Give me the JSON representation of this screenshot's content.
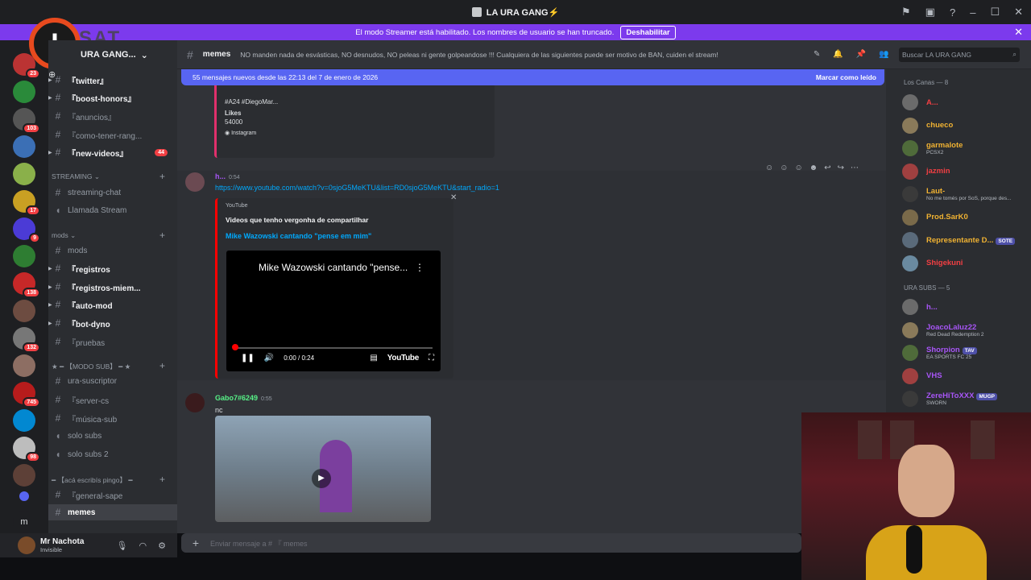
{
  "window": {
    "title": "LA URA GANG⚡️"
  },
  "banner": {
    "text": "El modo Streamer está habilitado. Los nombres de usuario se han truncado.",
    "button": "Deshabilitar"
  },
  "server": {
    "name": "URA GANG..."
  },
  "rail_badges": [
    "23",
    "103",
    "17",
    "9",
    "138",
    "132",
    "745",
    "98"
  ],
  "channels": [
    {
      "label": "『twitter』",
      "bold": true
    },
    {
      "label": "『boost-honors』",
      "bold": true
    },
    {
      "label": "『anuncios』",
      "bold": false
    },
    {
      "label": "『como-tener-rang...",
      "bold": false
    },
    {
      "label": "『new-videos』",
      "bold": true,
      "badge": "44"
    }
  ],
  "cat_streaming": "STREAMING",
  "streaming_channels": [
    "streaming-chat",
    "Llamada Stream"
  ],
  "cat_mods": "mods",
  "mods_channels": [
    {
      "label": "mods",
      "bold": false
    },
    {
      "label": "『registros",
      "bold": true
    },
    {
      "label": "『registros-miem...",
      "bold": true
    },
    {
      "label": "『auto-mod",
      "bold": true
    },
    {
      "label": "『bot-dyno",
      "bold": true
    },
    {
      "label": "『pruebas",
      "bold": false
    }
  ],
  "cat_modosub": "★ ━ 【MODO SUB】 ━ ★",
  "modosub_channels": [
    "ura-suscriptor",
    "『server-cs",
    "『música-sub",
    "solo subs",
    "solo subs 2"
  ],
  "cat_aca": "━ 【acá escribís pingo】 ━",
  "aca_channels": [
    "『general-sape",
    "memes"
  ],
  "user": {
    "name": "Mr Nachota",
    "status": "Invisible"
  },
  "chat_header": {
    "channel": "memes",
    "topic": "NO manden nada de esvásticas, NO desnudos, NO peleas ni gente golpeandose !!! Cualquiera de las siguientes puede ser motivo de BAN, cuiden el stream!",
    "search_placeholder": "Buscar LA URA GANG"
  },
  "new_messages_bar": {
    "text": "55 mensajes nuevos desde las 22:13 del 7 de enero de 2026",
    "action": "Marcar como leído"
  },
  "old_embed": {
    "line1": "#A24 #DiegoMar...",
    "likes_label": "Likes",
    "likes_value": "54000",
    "footer": "Instagram"
  },
  "message1": {
    "author": "h...",
    "time": "0:54",
    "link": "https://www.youtube.com/watch?v=0sjoG5MeKTU&list=RD0sjoG5MeKTU&start_radio=1",
    "provider": "YouTube",
    "embed_title": "Videos que tenho vergonha de compartilhar",
    "video_title": "Mike Wazowski cantando \"pense em mim\"",
    "player_title": "Mike Wazowski cantando \"pense...",
    "time_display": "0:00 / 0:24",
    "yt_logo": "YouTube"
  },
  "message2": {
    "author": "Gabo7#6249",
    "time": "0:55",
    "text": "nc"
  },
  "composer": {
    "placeholder": "Enviar mensaje a # 『 memes"
  },
  "members": {
    "group1": "Los Canas — 8",
    "list1": [
      {
        "name": "A...",
        "color": "#f23f43",
        "sub": ""
      },
      {
        "name": "chueco",
        "color": "#f0b232",
        "sub": ""
      },
      {
        "name": "garmalote",
        "color": "#f0b232",
        "sub": "PCSX2"
      },
      {
        "name": "jazmin",
        "color": "#f23f43",
        "sub": ""
      },
      {
        "name": "Laut-",
        "color": "#f0b232",
        "sub": "No me tomés por SoS, porque des..."
      },
      {
        "name": "Prod.SarK0",
        "color": "#f0b232",
        "sub": ""
      },
      {
        "name": "Representante D...",
        "color": "#f0b232",
        "sub": "",
        "tag": "SOTE"
      },
      {
        "name": "Shigekuni",
        "color": "#f23f43",
        "sub": ""
      }
    ],
    "group2": "URA SUBS — 5",
    "list2": [
      {
        "name": "h...",
        "color": "#a855f7",
        "sub": ""
      },
      {
        "name": "JoacoLaluz22",
        "color": "#a855f7",
        "sub": "Red Dead Redemption 2"
      },
      {
        "name": "Shorpion",
        "color": "#a855f7",
        "sub": "EA SPORTS FC 25",
        "tag": "TAV"
      },
      {
        "name": "VHS",
        "color": "#a855f7",
        "sub": ""
      },
      {
        "name": "ZereHiToXXX",
        "color": "#a855f7",
        "sub": "SWORN",
        "tag": "MUGP"
      }
    ]
  },
  "overlay_logo": {
    "letter": "I",
    "text": "SAT"
  },
  "colors": {
    "accent": "#5865f2",
    "banner": "#7c3aed",
    "link": "#00a8fc"
  }
}
